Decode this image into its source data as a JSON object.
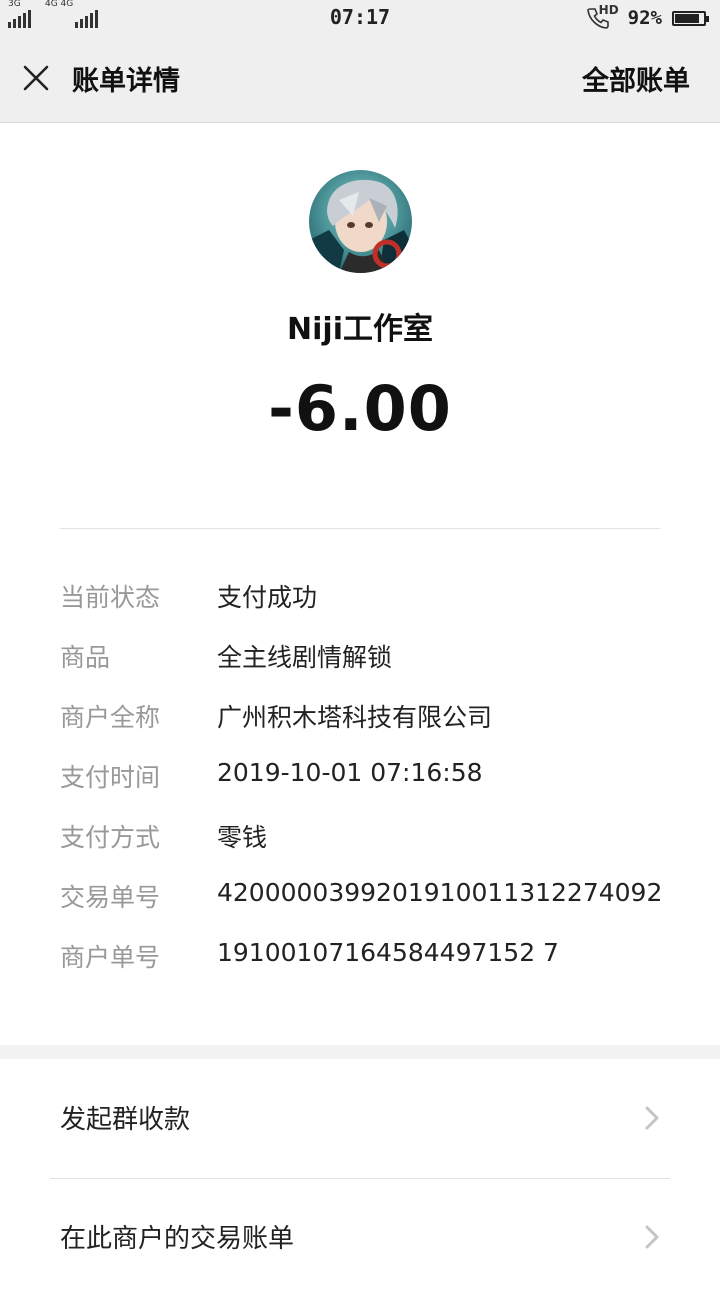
{
  "status_bar": {
    "signal1": "3G",
    "signal2": "4G 4G",
    "time": "07:17",
    "call_icon": "phone-hd-icon",
    "hd_label": "HD",
    "battery_percent": "92%",
    "battery_level": 0.92
  },
  "header": {
    "close_icon": "close-icon",
    "title": "账单详情",
    "right_link": "全部账单"
  },
  "merchant": {
    "avatar": "merchant-avatar",
    "name": "Niji工作室",
    "amount": "-6.00"
  },
  "details": [
    {
      "label": "当前状态",
      "value": "支付成功"
    },
    {
      "label": "商品",
      "value": "全主线剧情解锁"
    },
    {
      "label": "商户全称",
      "value": "广州积木塔科技有限公司"
    },
    {
      "label": "支付时间",
      "value": "2019-10-01 07:16:58"
    },
    {
      "label": "支付方式",
      "value": "零钱"
    },
    {
      "label": "交易单号",
      "value": "4200000399201910011312274092"
    },
    {
      "label": "商户单号",
      "value": "19100107164584497152 7"
    }
  ],
  "actions": [
    {
      "label": "发起群收款",
      "icon": "chevron-right-icon"
    },
    {
      "label": "在此商户的交易账单",
      "icon": "chevron-right-icon"
    }
  ],
  "colors": {
    "header_bg": "#efefef",
    "label_gray": "#999999",
    "text_dark": "#222222"
  }
}
